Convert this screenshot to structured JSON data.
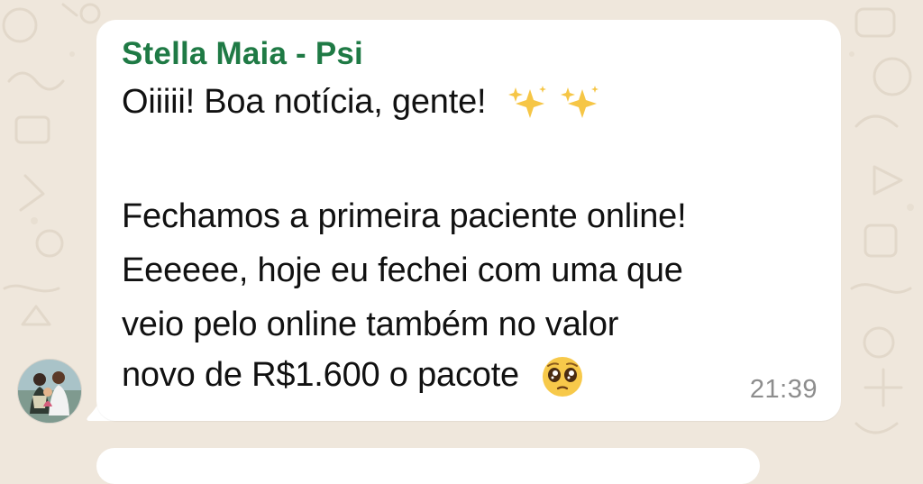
{
  "message": {
    "sender": "Stella Maia - Psi",
    "lines": [
      "Oiiiii! Boa notícia, gente!",
      "Fechamos a primeira paciente online!",
      "Eeeeee, hoje eu fechei com uma que",
      "veio pelo online também no valor",
      "novo de R$1.600 o pacote"
    ],
    "time": "21:39"
  },
  "icons": {
    "sparkles_1": "sparkles-emoji",
    "sparkles_2": "sparkles-emoji",
    "pleading": "pleading-face-emoji",
    "avatar": "avatar-photo"
  },
  "colors": {
    "background": "#efe7dc",
    "bubble": "#ffffff",
    "sender_name": "#1f7a45",
    "message_text": "#111111",
    "timestamp": "#8d8d8d"
  }
}
